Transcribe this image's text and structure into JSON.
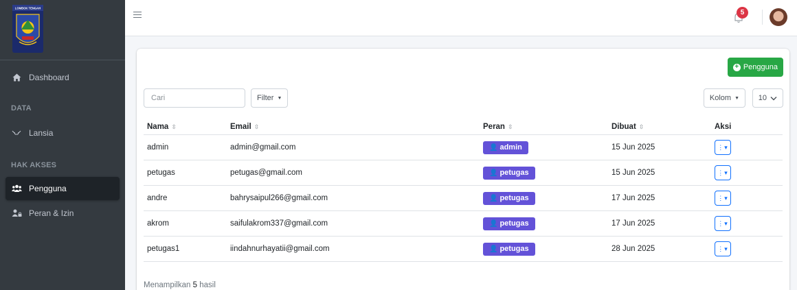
{
  "logo": {
    "caption": "LOMBOK TENGAH"
  },
  "sidebar": {
    "items": [
      {
        "label": "Dashboard",
        "icon": "home-icon"
      },
      {
        "label": "Lansia",
        "icon": "wheelchair-icon"
      },
      {
        "label": "Pengguna",
        "icon": "users-icon"
      },
      {
        "label": "Peran & Izin",
        "icon": "user-lock-icon"
      }
    ],
    "headers": [
      "DATA",
      "HAK AKSES"
    ],
    "active": "Pengguna"
  },
  "topbar": {
    "notification_count": "5"
  },
  "toolbar": {
    "add_label": "Pengguna",
    "search_placeholder": "Cari",
    "filter_label": "Filter",
    "columns_label": "Kolom",
    "per_page": "10"
  },
  "table": {
    "headers": [
      "Nama",
      "Email",
      "Peran",
      "Dibuat",
      "Aksi"
    ],
    "rows": [
      {
        "nama": "admin",
        "email": "admin@gmail.com",
        "peran": "admin",
        "dibuat": "15 Jun 2025"
      },
      {
        "nama": "petugas",
        "email": "petugas@gmail.com",
        "peran": "petugas",
        "dibuat": "15 Jun 2025"
      },
      {
        "nama": "andre",
        "email": "bahrysaipul266@gmail.com",
        "peran": "petugas",
        "dibuat": "17 Jun 2025"
      },
      {
        "nama": "akrom",
        "email": "saifulakrom337@gmail.com",
        "peran": "petugas",
        "dibuat": "17 Jun 2025"
      },
      {
        "nama": "petugas1",
        "email": "iindahnurhayatii@gmail.com",
        "peran": "petugas",
        "dibuat": "28 Jun 2025"
      }
    ]
  },
  "footer": {
    "prefix": "Menampilkan",
    "count": "5",
    "suffix": "hasil"
  },
  "colors": {
    "sidebar": "#343a40",
    "role_badge": "#6352d8",
    "add_button": "#28a745",
    "action_button": "#0d6efd",
    "notification": "#dc3545"
  }
}
